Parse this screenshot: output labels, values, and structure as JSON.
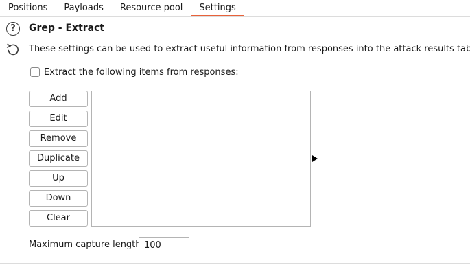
{
  "tabs": [
    {
      "label": "Positions",
      "active": false
    },
    {
      "label": "Payloads",
      "active": false
    },
    {
      "label": "Resource pool",
      "active": false
    },
    {
      "label": "Settings",
      "active": true
    }
  ],
  "section": {
    "help_icon": "question-mark-icon",
    "refresh_icon": "restore-defaults-icon",
    "title": "Grep - Extract",
    "description": "These settings can be used to extract useful information from responses into the attack results table."
  },
  "extract_checkbox": {
    "label": "Extract the following items from responses:",
    "checked": false
  },
  "buttons": {
    "add": "Add",
    "edit": "Edit",
    "remove": "Remove",
    "duplicate": "Duplicate",
    "up": "Up",
    "down": "Down",
    "clear": "Clear"
  },
  "items_list": [],
  "max_capture": {
    "label": "Maximum capture length:",
    "value": "100"
  },
  "colors": {
    "active_tab_underline": "#e8623a"
  }
}
